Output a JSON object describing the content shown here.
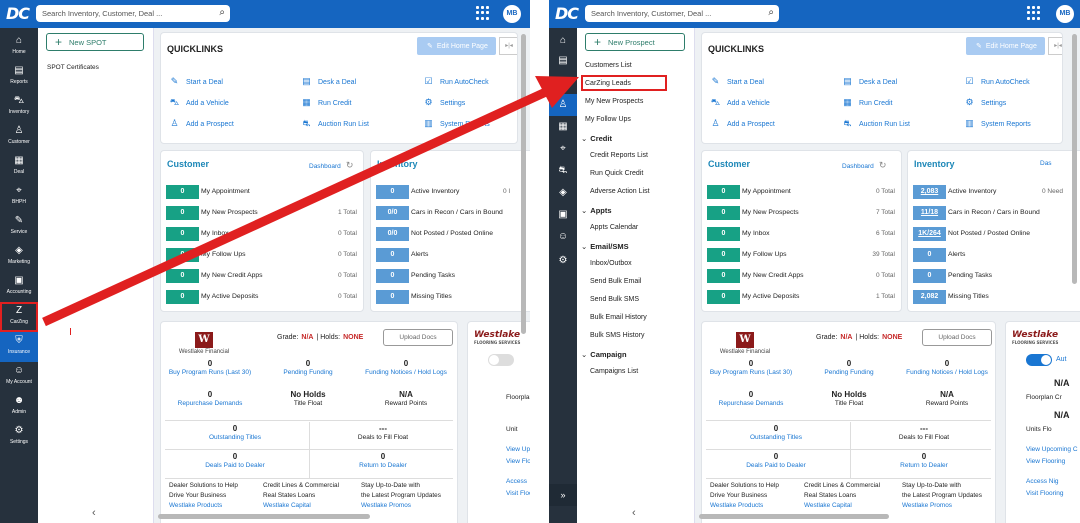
{
  "app": {
    "logo": "DC",
    "search_placeholder": "Search Inventory, Customer, Deal ...",
    "user_initials": "MB"
  },
  "nav_left": [
    {
      "label": "Home",
      "icon": "⌂"
    },
    {
      "label": "Reports",
      "icon": "▤"
    },
    {
      "label": "Inventory",
      "icon": "⛍"
    },
    {
      "label": "Customer",
      "icon": "♙"
    },
    {
      "label": "Deal",
      "icon": "▦"
    },
    {
      "label": "BHPH",
      "icon": "⌖"
    },
    {
      "label": "Service",
      "icon": "✎"
    },
    {
      "label": "Marketing",
      "icon": "◈"
    },
    {
      "label": "Accounting",
      "icon": "▣"
    },
    {
      "label": "CarZing",
      "icon": "Z"
    },
    {
      "label": "Insurance",
      "icon": "⛨"
    },
    {
      "label": "My Account",
      "icon": "☺"
    },
    {
      "label": "Admin",
      "icon": "☻"
    },
    {
      "label": "Settings",
      "icon": "⚙"
    }
  ],
  "spot": {
    "new_button": "New SPOT",
    "item": "SPOT Certificates"
  },
  "quicklinks": {
    "title": "QUICKLINKS",
    "edit_button": "Edit Home Page",
    "links": [
      {
        "label": "Start a Deal",
        "icon": "✎"
      },
      {
        "label": "Desk a Deal",
        "icon": "▤"
      },
      {
        "label": "Run AutoCheck",
        "icon": "☑"
      },
      {
        "label": "Add a Vehicle",
        "icon": "⛍"
      },
      {
        "label": "Run Credit",
        "icon": "▦"
      },
      {
        "label": "Settings",
        "icon": "⚙"
      },
      {
        "label": "Add a Prospect",
        "icon": "♙"
      },
      {
        "label": "Auction Run List",
        "icon": "⛐"
      },
      {
        "label": "System Reports",
        "icon": "▥"
      }
    ]
  },
  "customer_card": {
    "title": "Customer",
    "dashboard_link": "Dashboard",
    "left_rows": [
      {
        "value": "0",
        "label": "My Appointment",
        "total": ""
      },
      {
        "value": "0",
        "label": "My New Prospects",
        "total": "1 Total"
      },
      {
        "value": "0",
        "label": "My Inbox",
        "total": "0 Total"
      },
      {
        "value": "0",
        "label": "My Follow Ups",
        "total": "0 Total"
      },
      {
        "value": "0",
        "label": "My New Credit Apps",
        "total": "0 Total"
      },
      {
        "value": "0",
        "label": "My Active Deposits",
        "total": "0 Total"
      }
    ],
    "right_rows": [
      {
        "value": "0",
        "label": "My Appointment",
        "total": "0 Total"
      },
      {
        "value": "0",
        "label": "My New Prospects",
        "total": "7 Total"
      },
      {
        "value": "0",
        "label": "My Inbox",
        "total": "6 Total"
      },
      {
        "value": "0",
        "label": "My Follow Ups",
        "total": "39 Total"
      },
      {
        "value": "0",
        "label": "My New Credit Apps",
        "total": "0 Total"
      },
      {
        "value": "0",
        "label": "My Active Deposits",
        "total": "1 Total"
      }
    ]
  },
  "inventory_card": {
    "title_left": "Inventory",
    "title_right": "Inventory",
    "dash_fragment": "Das",
    "left_rows": [
      {
        "value": "0",
        "label": "Active Inventory",
        "total": "0 I"
      },
      {
        "value": "0/0",
        "label": "Cars in Recon / Cars in Bound",
        "total": ""
      },
      {
        "value": "0/0",
        "label": "Not Posted / Posted Online",
        "total": ""
      },
      {
        "value": "0",
        "label": "Alerts",
        "total": ""
      },
      {
        "value": "0",
        "label": "Pending Tasks",
        "total": ""
      },
      {
        "value": "0",
        "label": "Missing Titles",
        "total": ""
      }
    ],
    "right_rows": [
      {
        "value": "2,083",
        "label": "Active Inventory",
        "total": "0 Need"
      },
      {
        "value": "11/18",
        "label": "Cars in Recon / Cars in Bound",
        "total": ""
      },
      {
        "value": "1K/264",
        "label": "Not Posted / Posted Online",
        "total": ""
      },
      {
        "value": "0",
        "label": "Alerts",
        "total": ""
      },
      {
        "value": "0",
        "label": "Pending Tasks",
        "total": ""
      },
      {
        "value": "2,082",
        "label": "Missing Titles",
        "total": ""
      }
    ]
  },
  "westlake": {
    "logo_text": "Westlake Financial",
    "grade_label": "Grade:",
    "grade_value": "N/A",
    "holds_label": "| Holds:",
    "holds_value": "NONE",
    "upload_button": "Upload Docs",
    "r1": [
      {
        "value": "0",
        "label": "Buy Program Runs (Last 30)"
      },
      {
        "value": "0",
        "label": "Pending Funding"
      },
      {
        "value": "0",
        "label": "Funding Notices / Hold Logs"
      }
    ],
    "r2": [
      {
        "value": "0",
        "label": "Repurchase Demands"
      },
      {
        "value": "No Holds",
        "label": "Title Float"
      },
      {
        "value": "N/A",
        "label": "Reward Points"
      }
    ],
    "r3": [
      {
        "value": "0",
        "label": "Outstanding Titles"
      },
      {
        "value": "---",
        "label": "Deals to Fill Float"
      }
    ],
    "r4": [
      {
        "value": "0",
        "label": "Deals Paid to Dealer"
      },
      {
        "value": "0",
        "label": "Return to Dealer"
      }
    ],
    "promos": [
      {
        "line1": "Dealer Solutions to Help",
        "line2": "Drive Your Business",
        "link": "Westlake Products"
      },
      {
        "line1": "Credit Lines & Commercial",
        "line2": "Real States Loans",
        "link": "Westlake Capital"
      },
      {
        "line1": "Stay Up-to-Date with",
        "line2": "the Latest Program Updates",
        "link": "Westlake Promos"
      }
    ]
  },
  "flooring": {
    "logo_text": "Westlake",
    "sub_text": "FLOORING SERVICES",
    "na": "N/A",
    "floor_left": "Floorplan",
    "floor_right": "Floorplan Cr",
    "units_left": "Unit",
    "units_right": "Units Flo",
    "auto_label": "Aut",
    "view_upcoming_left": "View Upcom",
    "view_upcoming_right": "View Upcoming C",
    "view_flooring_left": "View Floo",
    "view_flooring_right": "View Flooring",
    "access_left": "Access",
    "access_right": "Access Nig",
    "visit_left": "Visit Floo",
    "visit_right": "Visit Flooring"
  },
  "right_menu": {
    "new_button": "New Prospect",
    "top_items": [
      "Customers List",
      "CarZing Leads",
      "My New Prospects",
      "My Follow Ups"
    ],
    "groups": [
      {
        "title": "Credit",
        "items": [
          "Credit Reports List",
          "Run Quick Credit",
          "Adverse Action List"
        ]
      },
      {
        "title": "Appts",
        "items": [
          "Appts Calendar"
        ]
      },
      {
        "title": "Email/SMS",
        "items": [
          "Inbox/Outbox",
          "Send Bulk Email",
          "Send Bulk SMS",
          "Bulk Email History",
          "Bulk SMS History"
        ]
      },
      {
        "title": "Campaign",
        "items": [
          "Campaigns List"
        ]
      }
    ]
  },
  "right_nav_icons": [
    "⌂",
    "▤",
    "⛍",
    "♙",
    "▦",
    "⌖",
    "⛐",
    "◈",
    "▣",
    "☺",
    "⚙"
  ],
  "colors": {
    "brand": "#1565c0",
    "rail": "#26313d",
    "teal_badge": "#17a185",
    "blue_badge": "#5a9bd5",
    "highlight": "#e02020"
  }
}
